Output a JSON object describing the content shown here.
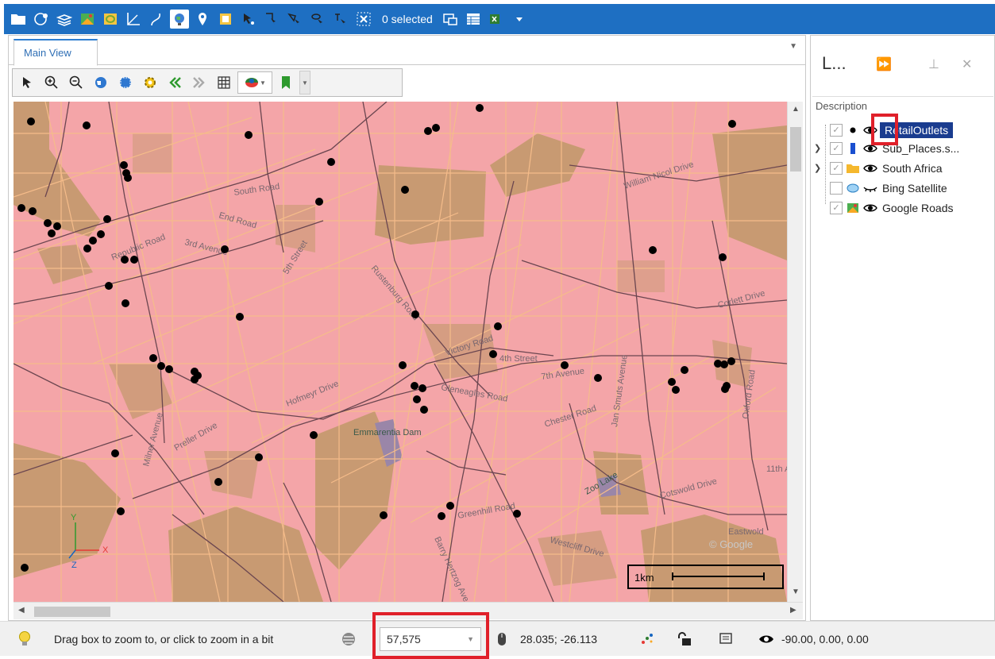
{
  "toolbar": {
    "selected_count": "0 selected",
    "icons": [
      "folder-icon",
      "globe-settings-icon",
      "layers-icon",
      "map-icon",
      "frame-icon",
      "measure-icon",
      "route-icon",
      "globe-icon",
      "pin-icon",
      "pan-icon",
      "select-arrow-icon",
      "select-rect-icon",
      "select-poly-icon",
      "select-lasso-icon",
      "select-line-icon",
      "clear-selection-icon",
      "zoom-selection-icon",
      "attribute-table-icon",
      "excel-export-icon",
      "more-dropdown-icon"
    ]
  },
  "main_view": {
    "tab_label": "Main View"
  },
  "map": {
    "labels": {
      "william_nicol": "William Nicol Drive",
      "south_road": "South Road",
      "end_road": "End Road",
      "republic_road": "Republic Road",
      "third_avenue": "3rd Avenue",
      "fifth_street": "5th Street",
      "rustenburg": "Rustenburg Road",
      "victory_road": "Victory Road",
      "fourth_street": "4th Street",
      "seventh_avenue": "7th Avenue",
      "gleneagles": "Gleneagles Road",
      "hofmeyr": "Hofmeyr Drive",
      "emmarentia": "Emmarentia Dam",
      "preller": "Preller Drive",
      "chester": "Chester Road",
      "jan_smuts": "Jan Smuts Avenue",
      "zoo_lake": "Zoo Lake",
      "greenhill": "Greenhill Road",
      "westcliff": "Westcliff Drive",
      "cotswold": "Cotswold Drive",
      "corlett": "Corlett Drive",
      "oxford": "Oxford Road",
      "eleventh": "11th A",
      "eastwold": "Eastwold",
      "barry_hertzog": "Barry Hertzog Ave",
      "milner": "Milner Avenue",
      "google_mark": "© Google",
      "scale_label": "1km"
    },
    "axis": {
      "x": "X",
      "y": "Y",
      "z": "Z"
    }
  },
  "layers_panel": {
    "title": "L...",
    "column_header": "Description",
    "layers": [
      {
        "name": "RetailOutlets",
        "checked": true,
        "selected": true
      },
      {
        "name": "Sub_Places.s...",
        "checked": true,
        "selected": false
      },
      {
        "name": "South Africa",
        "checked": true,
        "selected": false
      },
      {
        "name": "Bing Satellite",
        "checked": false,
        "selected": false
      },
      {
        "name": "Google Roads",
        "checked": true,
        "selected": false
      }
    ]
  },
  "status": {
    "hint": "Drag box to zoom to, or click to zoom in a bit",
    "scale": "57,575",
    "coords": "28.035; -26.113",
    "camera": "-90.00, 0.00, 0.00"
  },
  "colors": {
    "toolbar_blue": "#1e6fc2",
    "map_base": "#f4a5a8",
    "map_park": "#c89a72",
    "selection_blue": "#1a3c8f",
    "highlight_red": "#e0202a"
  }
}
